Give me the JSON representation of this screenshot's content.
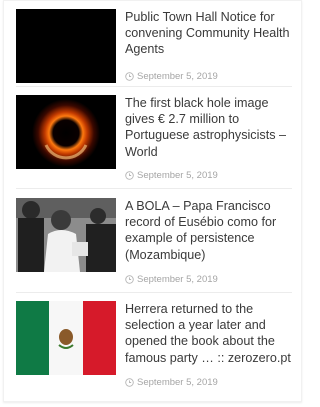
{
  "posts": [
    {
      "title": "Public Town Hall Notice for convening Community Health Agents",
      "date": "September 5, 2019",
      "image": "black-placeholder"
    },
    {
      "title": "The first black hole image gives € 2.7 million to Portuguese astrophysicists – World",
      "date": "September 5, 2019",
      "image": "black-hole"
    },
    {
      "title": "A BOLA – Papa Francisco record of Eusébio como for example of persistence (Mozambique)",
      "date": "September 5, 2019",
      "image": "bw-football-photo"
    },
    {
      "title": "Herrera returned to the selection a year later and opened the book about the famous party … :: zerozero.pt",
      "date": "September 5, 2019",
      "image": "mexico-flag"
    }
  ],
  "colors": {
    "title": "#3a3a3a",
    "meta": "#a5a5a5",
    "divider": "#ececec"
  }
}
